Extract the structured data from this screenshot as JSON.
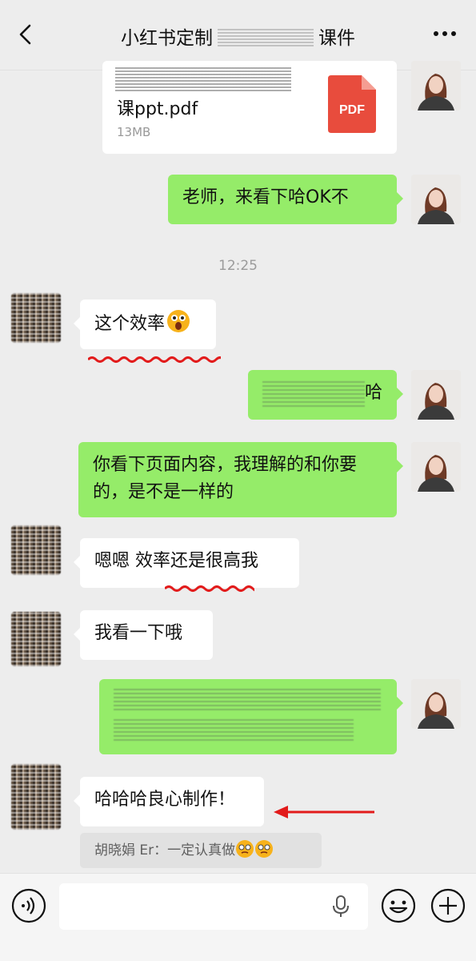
{
  "header": {
    "title_left": "小红书定制",
    "title_right": "课件"
  },
  "file": {
    "name": "课ppt.pdf",
    "size": "13MB",
    "type_label": "PDF"
  },
  "timestamp": "12:25",
  "messages": {
    "me_1": "老师，来看下哈OK不",
    "other_1": "这个效率",
    "me_2_visible": "哈",
    "me_3": "你看下页面内容，我理解的和你要的，是不是一样的",
    "other_2": "嗯嗯 效率还是很高我",
    "other_3": "我看一下哦",
    "other_4": "哈哈哈良心制作！"
  },
  "quote": {
    "text": "胡晓娟 Er：一定认真做"
  },
  "colors": {
    "my_bubble": "#95ec69",
    "their_bubble": "#ffffff",
    "pdf_red": "#e84c3d",
    "annotation_red": "#e21b1b"
  },
  "icons": {
    "back": "chevron-left-icon",
    "more": "more-dots-icon",
    "voice": "voice-icon",
    "mic": "mic-icon",
    "emoji": "emoji-icon",
    "add": "plus-circle-icon"
  }
}
